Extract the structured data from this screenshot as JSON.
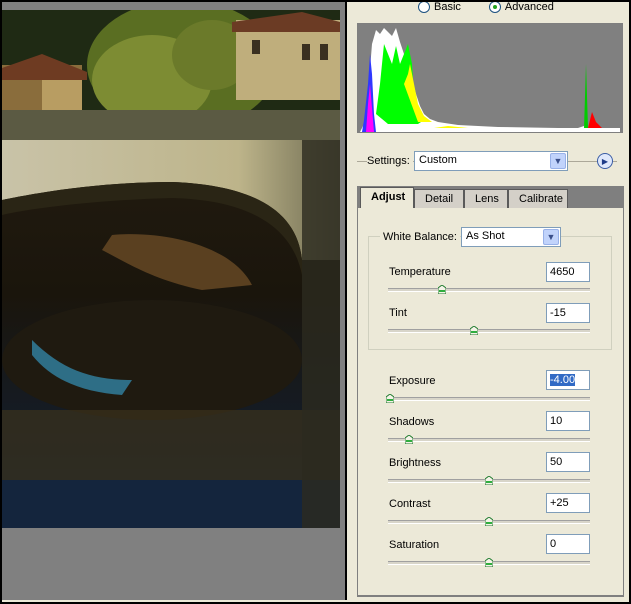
{
  "mode": {
    "basic_label": "Basic",
    "advanced_label": "Advanced",
    "selected": "Advanced"
  },
  "settings": {
    "label": "Settings:",
    "value": "Custom"
  },
  "tabs": [
    {
      "label": "Adjust",
      "active": true
    },
    {
      "label": "Detail",
      "active": false
    },
    {
      "label": "Lens",
      "active": false
    },
    {
      "label": "Calibrate",
      "active": false
    }
  ],
  "white_balance": {
    "label": "White Balance:",
    "value": "As Shot"
  },
  "controls": {
    "temperature": {
      "label": "Temperature",
      "value": "4650",
      "level": 0.27
    },
    "tint": {
      "label": "Tint",
      "value": "-15",
      "level": 0.43
    },
    "exposure": {
      "label": "Exposure",
      "value": "-4.00",
      "level": 0.0
    },
    "shadows": {
      "label": "Shadows",
      "value": "10",
      "level": 0.1
    },
    "brightness": {
      "label": "Brightness",
      "value": "50",
      "level": 0.5
    },
    "contrast": {
      "label": "Contrast",
      "value": "+25",
      "level": 0.5
    },
    "saturation": {
      "label": "Saturation",
      "value": "0",
      "level": 0.5
    }
  },
  "colors": {
    "panel": "#ece9d8",
    "preview_bg": "#808080",
    "selection": "#316ac5"
  },
  "icons": {
    "settings_dropdown": "chevron-down-icon",
    "settings_menu": "play-right-icon",
    "white_balance_dropdown": "chevron-down-icon"
  }
}
